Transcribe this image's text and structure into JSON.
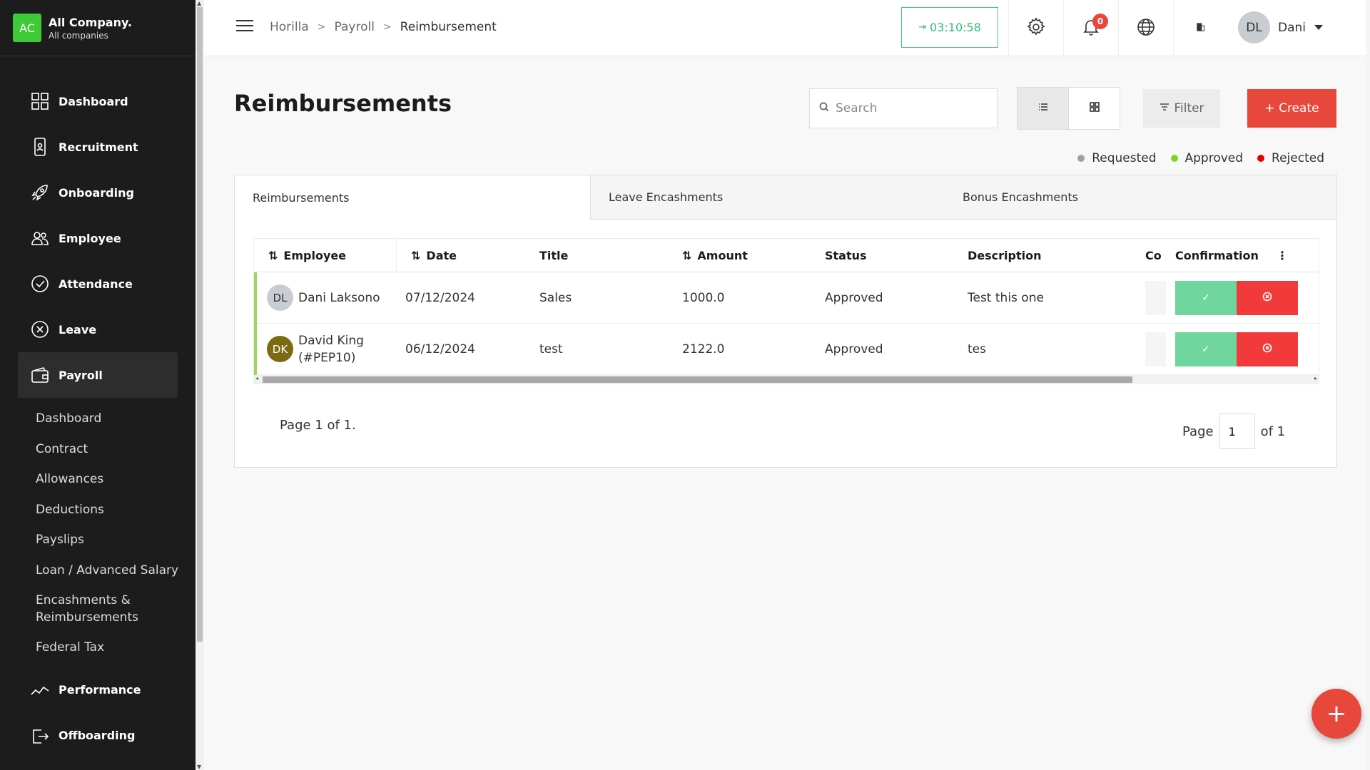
{
  "company": {
    "initials": "AC",
    "name": "All Company.",
    "sub": "All companies"
  },
  "sidebar": {
    "items": [
      {
        "label": "Dashboard",
        "icon": "dashboard-icon"
      },
      {
        "label": "Recruitment",
        "icon": "recruitment-icon"
      },
      {
        "label": "Onboarding",
        "icon": "rocket-icon"
      },
      {
        "label": "Employee",
        "icon": "people-icon"
      },
      {
        "label": "Attendance",
        "icon": "check-circle-icon"
      },
      {
        "label": "Leave",
        "icon": "x-circle-icon"
      },
      {
        "label": "Payroll",
        "icon": "wallet-icon"
      }
    ],
    "payroll_sub": [
      "Dashboard",
      "Contract",
      "Allowances",
      "Deductions",
      "Payslips",
      "Loan / Advanced Salary",
      "Encashments & Reimbursements",
      "Federal Tax"
    ],
    "items_after": [
      {
        "label": "Performance",
        "icon": "chart-line-icon"
      },
      {
        "label": "Offboarding",
        "icon": "exit-icon"
      }
    ]
  },
  "topbar": {
    "breadcrumb": [
      "Horilla",
      "Payroll",
      "Reimbursement"
    ],
    "timer": "03:10:58",
    "notification_count": "0",
    "user_initials": "DL",
    "user_name": "Dani"
  },
  "page": {
    "title": "Reimbursements",
    "search_placeholder": "Search",
    "filter_label": "Filter",
    "create_label": "+ Create"
  },
  "legend": [
    {
      "label": "Requested",
      "color": "#a0a0a0"
    },
    {
      "label": "Approved",
      "color": "#7ed321"
    },
    {
      "label": "Rejected",
      "color": "#e80000"
    }
  ],
  "tabs": [
    "Reimbursements",
    "Leave Encashments",
    "Bonus Encashments"
  ],
  "table": {
    "headers": {
      "employee": "Employee",
      "date": "Date",
      "title": "Title",
      "amount": "Amount",
      "status": "Status",
      "description": "Description",
      "co": "Co",
      "confirmation": "Confirmation"
    },
    "rows": [
      {
        "initials": "DL",
        "avatar_color": "#c8cdd2",
        "avatar_text_color": "#333333",
        "employee": "Dani Laksono",
        "date": "07/12/2024",
        "title": "Sales",
        "amount": "1000.0",
        "status": "Approved",
        "description": "Test this one"
      },
      {
        "initials": "DK",
        "avatar_color": "#7a6a12",
        "avatar_text_color": "#ffffff",
        "employee": "David King (#PEP10)",
        "date": "06/12/2024",
        "title": "test",
        "amount": "2122.0",
        "status": "Approved",
        "description": "tes"
      }
    ]
  },
  "pager": {
    "summary": "Page 1 of 1.",
    "page_label": "Page",
    "page_value": "1",
    "of_label": "of 1"
  }
}
